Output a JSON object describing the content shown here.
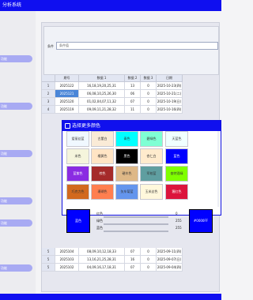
{
  "window": {
    "title": "分析系统"
  },
  "sidebar": {
    "items": [
      {
        "label": "功能"
      },
      {
        "label": "功能"
      },
      {
        "label": "功能"
      },
      {
        "label": "功能"
      },
      {
        "label": "功能"
      },
      {
        "label": "功能"
      }
    ]
  },
  "search": {
    "label": "条件",
    "value": "条件值"
  },
  "table": {
    "columns": [
      "期号",
      "数据 1",
      "数据 2",
      "数据 3",
      "日期"
    ],
    "rows": [
      {
        "index": "1",
        "cells": [
          "2025122",
          "16,18,19,20,25,31",
          "13",
          "0",
          "2025-10-23(四)"
        ]
      },
      {
        "index": "2",
        "cells": [
          "2025121",
          "06,08,10,25,26,30",
          "06",
          "0",
          "2025-10-21(二)"
        ]
      },
      {
        "index": "3",
        "cells": [
          "2025120",
          "01,02,04,07,11,32",
          "07",
          "0",
          "2025-10-19(日)"
        ]
      },
      {
        "index": "4",
        "cells": [
          "2025119",
          "09,09,11,21,28,32",
          "11",
          "0",
          "2025-10-16(四)"
        ]
      },
      {
        "index": "5",
        "cells": [
          "2025104",
          "08,09,10,12,18,33",
          "07",
          "0",
          "2025-09-11(四)"
        ]
      },
      {
        "index": "5",
        "cells": [
          "2025103",
          "13,16,21,25,28,31",
          "16",
          "0",
          "2025-09-07(日)"
        ]
      },
      {
        "index": "5",
        "cells": [
          "2025102",
          "04,09,16,17,18,31",
          "07",
          "0",
          "2025-09-04(四)"
        ]
      }
    ]
  },
  "dialog": {
    "title": "选择更多颜色",
    "swatches": [
      {
        "label": "爱丽丝蓝",
        "color": "#f0f8ff",
        "text": "#333333"
      },
      {
        "label": "古董白",
        "color": "#faebd7",
        "text": "#333333"
      },
      {
        "label": "青色",
        "color": "#00ffff",
        "text": "#333333"
      },
      {
        "label": "碧绿色",
        "color": "#7fffd4",
        "text": "#333333"
      },
      {
        "label": "天蓝色",
        "color": "#f0ffff",
        "text": "#333333"
      },
      {
        "label": "米色",
        "color": "#f5f5dc",
        "text": "#333333"
      },
      {
        "label": "橘黄色",
        "color": "#ffe4c4",
        "text": "#333333"
      },
      {
        "label": "黑色",
        "color": "#000000",
        "text": "#ffffff"
      },
      {
        "label": "杏仁白",
        "color": "#ffebcd",
        "text": "#333333"
      },
      {
        "label": "蓝色",
        "color": "#0000ff",
        "text": "#ffffff"
      },
      {
        "label": "蓝紫色",
        "color": "#8a2be2",
        "text": "#ffffff"
      },
      {
        "label": "棕色",
        "color": "#a52a2a",
        "text": "#ffffff"
      },
      {
        "label": "硬木色",
        "color": "#deb887",
        "text": "#333333"
      },
      {
        "label": "军校蓝",
        "color": "#5f9ea0",
        "text": "#333333"
      },
      {
        "label": "查特酒绿",
        "color": "#7fff00",
        "text": "#333333"
      },
      {
        "label": "巧克力色",
        "color": "#d2691e",
        "text": "#333333"
      },
      {
        "label": "珊瑚色",
        "color": "#ff7f50",
        "text": "#333333"
      },
      {
        "label": "矢车菊蓝",
        "color": "#6495ed",
        "text": "#333333"
      },
      {
        "label": "玉米丝色",
        "color": "#fff8dc",
        "text": "#333333"
      },
      {
        "label": "猩红色",
        "color": "#dc143c",
        "text": "#ffffff"
      }
    ],
    "preview_label": "蓝色",
    "red_label": "红色",
    "green_label": "绿色",
    "blue_label": "蓝色",
    "red_value": "0",
    "green_value": "255",
    "blue_value": "255",
    "red_level": 0,
    "green_level": 1,
    "blue_level": 1,
    "hex": "#0000FF",
    "color": "#0000ff"
  }
}
